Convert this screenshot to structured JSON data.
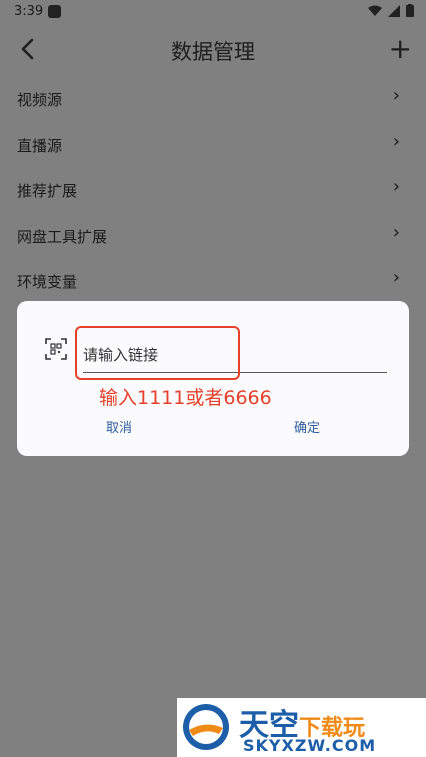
{
  "status_bar": {
    "time": "3:39"
  },
  "app_bar": {
    "title": "数据管理",
    "back_icon": "chevron-left-icon",
    "add_icon": "plus-icon"
  },
  "menu": {
    "items": [
      {
        "label": "视频源"
      },
      {
        "label": "直播源"
      },
      {
        "label": "推荐扩展"
      },
      {
        "label": "网盘工具扩展"
      },
      {
        "label": "环境变量"
      }
    ]
  },
  "dialog": {
    "input_placeholder": "请输入链接",
    "hint": "输入1111或者6666",
    "cancel_label": "取消",
    "ok_label": "确定"
  },
  "watermark": {
    "brand_main": "天空",
    "brand_sub": "下载玩",
    "url": "SKYXZW.COM"
  },
  "colors": {
    "accent_button": "#2e5d9e",
    "annotation_red": "#e5402a",
    "scrim": "#808080"
  }
}
